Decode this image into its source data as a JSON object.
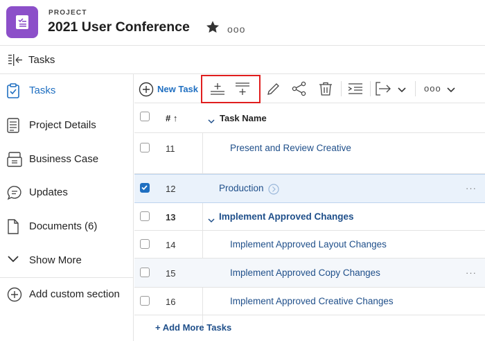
{
  "header": {
    "eyebrow": "PROJECT",
    "title": "2021 User Conference",
    "more_label": "ooo"
  },
  "tasksbar": {
    "label": "Tasks"
  },
  "sidebar": {
    "items": [
      {
        "label": "Tasks",
        "icon": "task-clipboard-icon",
        "active": true
      },
      {
        "label": "Project Details",
        "icon": "document-lines-icon"
      },
      {
        "label": "Business Case",
        "icon": "briefcase-stack-icon"
      },
      {
        "label": "Updates",
        "icon": "chat-bubble-icon"
      },
      {
        "label": "Documents (6)",
        "icon": "document-icon"
      },
      {
        "label": "Show More",
        "icon": "chevron-down-icon"
      },
      {
        "label": "Add custom section",
        "icon": "plus-circle-icon"
      }
    ]
  },
  "toolbar": {
    "new_task_label": "New Task",
    "more_label": "ooo"
  },
  "table": {
    "headers": {
      "num": "#",
      "sort_arrow": "↑",
      "name": "Task Name"
    },
    "rows": [
      {
        "num": "11",
        "name": "Present and Review Creative"
      },
      {
        "num": "12",
        "name": "Production"
      },
      {
        "num": "13",
        "name": "Implement Approved Changes"
      },
      {
        "num": "14",
        "name": "Implement Approved Layout Changes"
      },
      {
        "num": "15",
        "name": "Implement Approved Copy Changes"
      },
      {
        "num": "16",
        "name": "Implement Approved Creative Changes"
      }
    ],
    "row_more": "···",
    "add_more_label": "+ Add More Tasks"
  },
  "colors": {
    "accent": "#1f6fc1",
    "link": "#1f4f8a",
    "project_icon": "#8c4fc9",
    "highlight": "#e01e1e"
  }
}
